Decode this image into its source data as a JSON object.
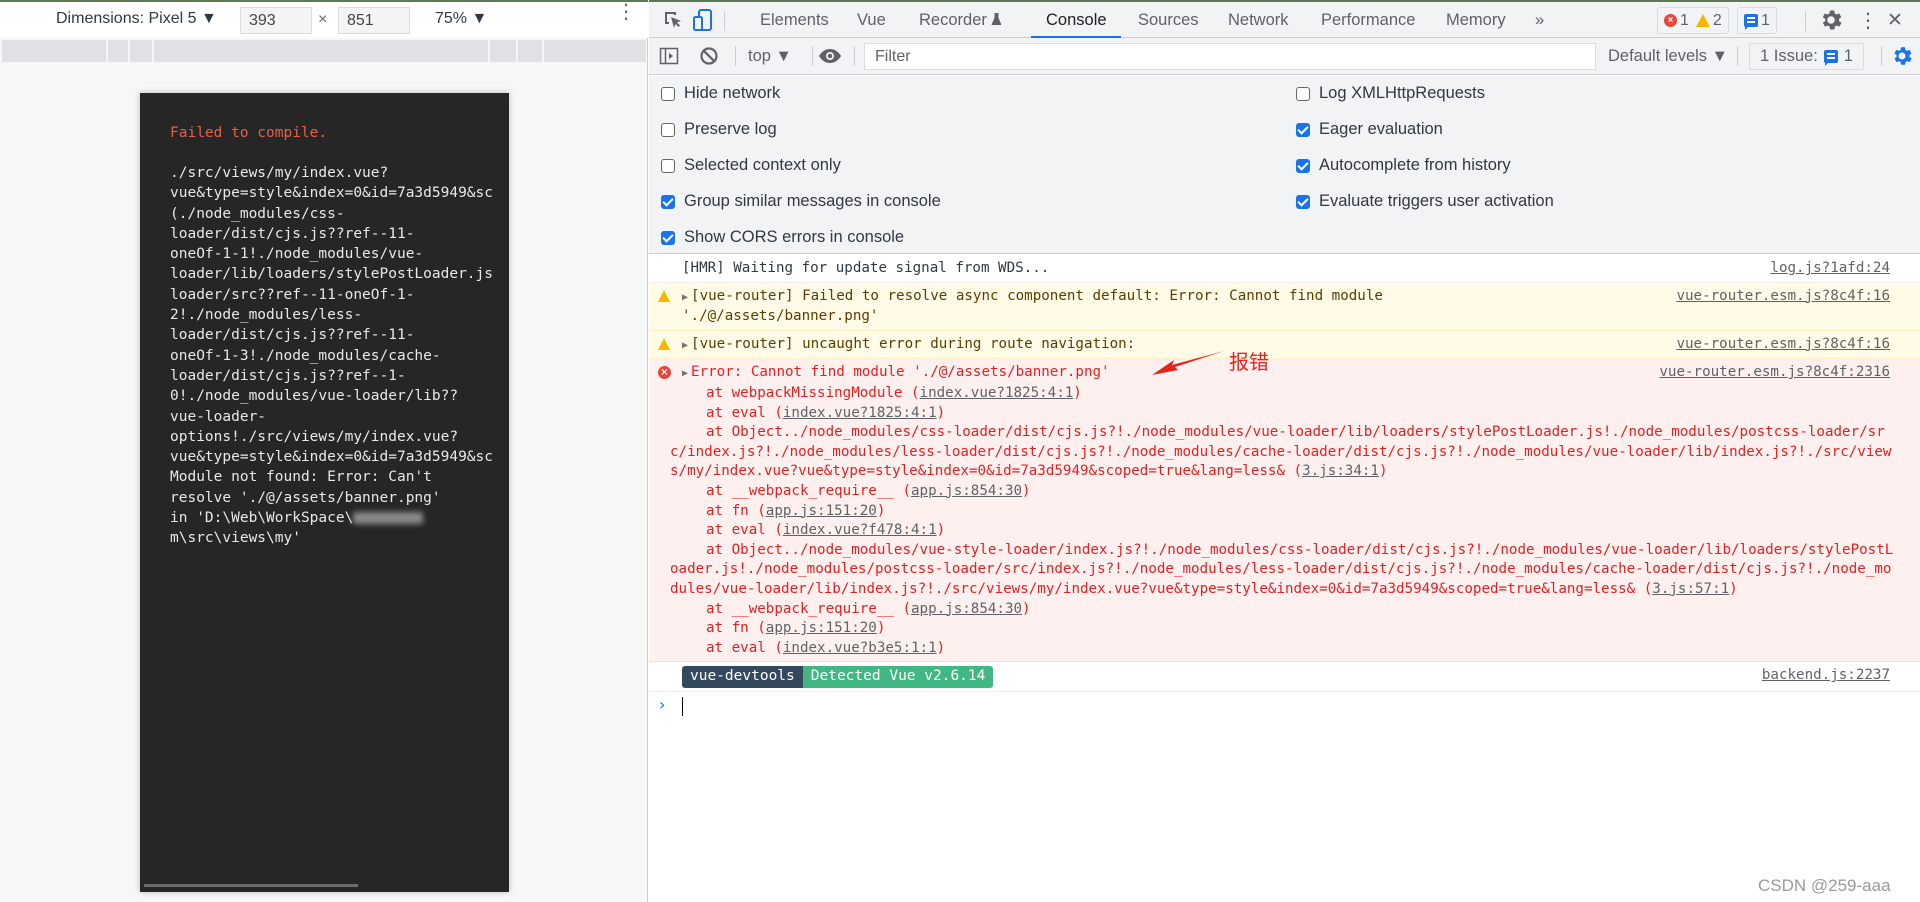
{
  "device_toolbar": {
    "dimensions_label": "Dimensions: Pixel 5 ▼",
    "width": "393",
    "times": "×",
    "height": "851",
    "zoom": "75% ▼",
    "more": "⋮"
  },
  "device_overlay": {
    "title": "Failed to compile.",
    "lines": [
      "./src/views/my/index.vue?",
      "vue&type=style&index=0&id=7a3d5949&sc",
      "(./node_modules/css-",
      "loader/dist/cjs.js??ref--11-",
      "oneOf-1-1!./node_modules/vue-",
      "loader/lib/loaders/stylePostLoader.js",
      "loader/src??ref--11-oneOf-1-",
      "2!./node_modules/less-",
      "loader/dist/cjs.js??ref--11-",
      "oneOf-1-3!./node_modules/cache-",
      "loader/dist/cjs.js??ref--1-",
      "0!./node_modules/vue-loader/lib??",
      "vue-loader-",
      "options!./src/views/my/index.vue?",
      "vue&type=style&index=0&id=7a3d5949&sc",
      "Module not found: Error: Can't",
      "resolve './@/assets/banner.png'",
      "in 'D:\\Web\\WorkSpace\\",
      "m\\src\\views\\my'"
    ]
  },
  "devtools": {
    "tabs": [
      {
        "label": "Elements",
        "active": false
      },
      {
        "label": "Vue",
        "active": false
      },
      {
        "label": "Recorder",
        "active": false
      },
      {
        "label": "Console",
        "active": true
      },
      {
        "label": "Sources",
        "active": false
      },
      {
        "label": "Network",
        "active": false
      },
      {
        "label": "Performance",
        "active": false
      },
      {
        "label": "Memory",
        "active": false
      }
    ],
    "more_tabs": "»",
    "counts": {
      "errors": "1",
      "warnings": "2",
      "messages": "1"
    },
    "close": "✕",
    "toolbar": {
      "context": "top ▼",
      "filter_placeholder": "Filter",
      "levels": "Default levels ▼",
      "issues_label": "1 Issue:",
      "issues_count": "1"
    },
    "settings_left": [
      {
        "label": "Hide network",
        "checked": false
      },
      {
        "label": "Preserve log",
        "checked": false
      },
      {
        "label": "Selected context only",
        "checked": false
      },
      {
        "label": "Group similar messages in console",
        "checked": true
      },
      {
        "label": "Show CORS errors in console",
        "checked": true
      }
    ],
    "settings_right": [
      {
        "label": "Log XMLHttpRequests",
        "checked": false
      },
      {
        "label": "Eager evaluation",
        "checked": true
      },
      {
        "label": "Autocomplete from history",
        "checked": true
      },
      {
        "label": "Evaluate triggers user activation",
        "checked": true
      }
    ]
  },
  "console": {
    "msg_hmr": {
      "text": "[HMR] Waiting for update signal from WDS...",
      "source": "log.js?1afd:24"
    },
    "msg_warn1": {
      "text": "[vue-router] Failed to resolve async component default: Error: Cannot find module\n'./@/assets/banner.png'",
      "source": "vue-router.esm.js?8c4f:16"
    },
    "msg_warn2": {
      "text": "[vue-router] uncaught error during route navigation:",
      "source": "vue-router.esm.js?8c4f:16"
    },
    "msg_error": {
      "head": "Error: Cannot find module './@/assets/banner.png'",
      "source": "vue-router.esm.js?8c4f:2316",
      "stack": [
        {
          "pre": "at webpackMissingModule (",
          "link": "index.vue?1825:4:1",
          "post": ")"
        },
        {
          "pre": "at eval (",
          "link": "index.vue?1825:4:1",
          "post": ")"
        },
        {
          "pre": "at Object../node_modules/css-loader/dist/cjs.js?!./node_modules/vue-loader/lib/loaders/stylePostLoader.js!./node_modules/postcss-loader/src/index.js?!./node_modules/less-loader/dist/cjs.js?!./node_modules/cache-loader/dist/cjs.js?!./node_modules/vue-loader/lib/index.js?!./src/views/my/index.vue?vue&type=style&index=0&id=7a3d5949&scoped=true&lang=less& (",
          "link": "3.js:34:1",
          "post": ")"
        },
        {
          "pre": "at __webpack_require__ (",
          "link": "app.js:854:30",
          "post": ")"
        },
        {
          "pre": "at fn (",
          "link": "app.js:151:20",
          "post": ")"
        },
        {
          "pre": "at eval (",
          "link": "index.vue?f478:4:1",
          "post": ")"
        },
        {
          "pre": "at Object../node_modules/vue-style-loader/index.js?!./node_modules/css-loader/dist/cjs.js?!./node_modules/vue-loader/lib/loaders/stylePostLoader.js!./node_modules/postcss-loader/src/index.js?!./node_modules/less-loader/dist/cjs.js?!./node_modules/cache-loader/dist/cjs.js?!./node_modules/vue-loader/lib/index.js?!./src/views/my/index.vue?vue&type=style&index=0&id=7a3d5949&scoped=true&lang=less& (",
          "link": "3.js:57:1",
          "post": ")"
        },
        {
          "pre": "at __webpack_require__ (",
          "link": "app.js:854:30",
          "post": ")"
        },
        {
          "pre": "at fn (",
          "link": "app.js:151:20",
          "post": ")"
        },
        {
          "pre": "at eval (",
          "link": "index.vue?b3e5:1:1",
          "post": ")"
        }
      ]
    },
    "msg_devtools": {
      "badge_left": "vue-devtools",
      "badge_right": "Detected Vue v2.6.14",
      "source": "backend.js:2237"
    },
    "prompt": "›"
  },
  "annotation": {
    "label": "报错",
    "color": "#e8231d"
  },
  "watermark": "CSDN @259-aaa",
  "colors": {
    "accent": "#1a73e8",
    "error": "#e41f1f",
    "warning_bg": "#fffbe6",
    "error_bg": "#fff0f0",
    "vue_green": "#41b883",
    "vue_navy": "#35495e"
  }
}
